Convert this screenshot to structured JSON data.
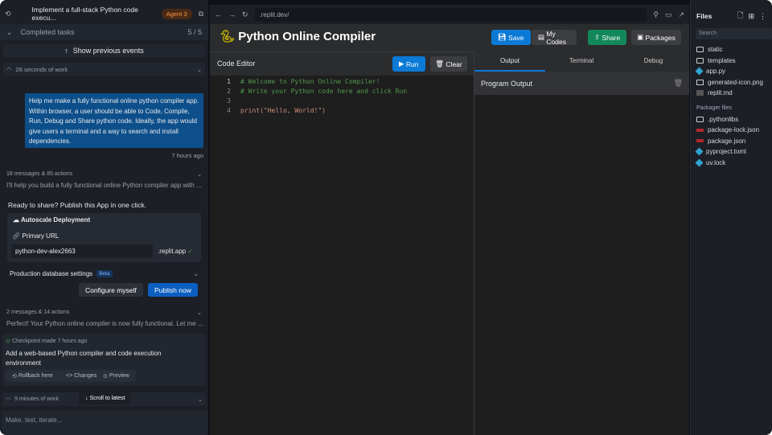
{
  "agent": {
    "title": "Implement a full-stack Python code execu...",
    "badge": "Agent 3",
    "completed_label": "Completed tasks",
    "completed_count": "5 / 5",
    "show_previous": "Show previous events",
    "work1": "26 seconds of work",
    "user_message": "Help me make a fully functional online python compiler app. Within browser, a user should be able to Code, Compile, Run, Debug and Share python code. Ideally, the app would give users a terminal and a way to search and install dependencies.",
    "user_time": "7 hours ago",
    "summary1": "18 messages & 85 actions",
    "summary1_preview": "I'll help you build a fully functional online Python compiler app with ...",
    "publish_prompt": "Ready to share? Publish this App in one click.",
    "deployment": "Autoscale Deployment",
    "primary_url": "Primary URL",
    "url_value": "python-dev-alex2663",
    "url_suffix": ".replit.app",
    "db_settings": "Production database settings",
    "beta": "Beta",
    "configure": "Configure myself",
    "publish": "Publish now",
    "summary2": "2 messages & 14 actions",
    "summary2_preview": "Perfect! Your Python online compiler is now fully functional. Let me ...",
    "checkpoint": "Checkpoint made 7 hours ago",
    "checkpoint_text": "Add a web-based Python compiler and code execution environment",
    "rollback": "Rollback here",
    "changes": "Changes",
    "preview": "Preview",
    "work2": "9 minutes of work",
    "scroll_latest": "Scroll to latest",
    "input_placeholder": "Make, test, iterate..."
  },
  "browser": {
    "url": ".replit.dev/"
  },
  "app": {
    "title": "Python Online Compiler",
    "save": "Save",
    "my_codes": "My Codes",
    "share": "Share",
    "packages": "Packages",
    "editor_label": "Code Editor",
    "run": "Run",
    "clear": "Clear",
    "code": [
      {
        "n": "1",
        "t": "# Welcome to Python Online Compiler!"
      },
      {
        "n": "2",
        "t": "# Write your Python code here and click Run"
      },
      {
        "n": "3",
        "t": ""
      },
      {
        "n": "4",
        "t": "print(\"Hello, World!\")"
      }
    ],
    "tabs": [
      "Output",
      "Terminal",
      "Debug"
    ],
    "output_title": "Program Output"
  },
  "files": {
    "title": "Files",
    "search": "Search",
    "items": [
      "static",
      "templates",
      "app.py",
      "generated-icon.png",
      "replit.md"
    ],
    "packager_label": "Packager files",
    "packager": [
      ".pythonlibs",
      "package-lock.json",
      "package.json",
      "pyproject.toml",
      "uv.lock"
    ]
  }
}
